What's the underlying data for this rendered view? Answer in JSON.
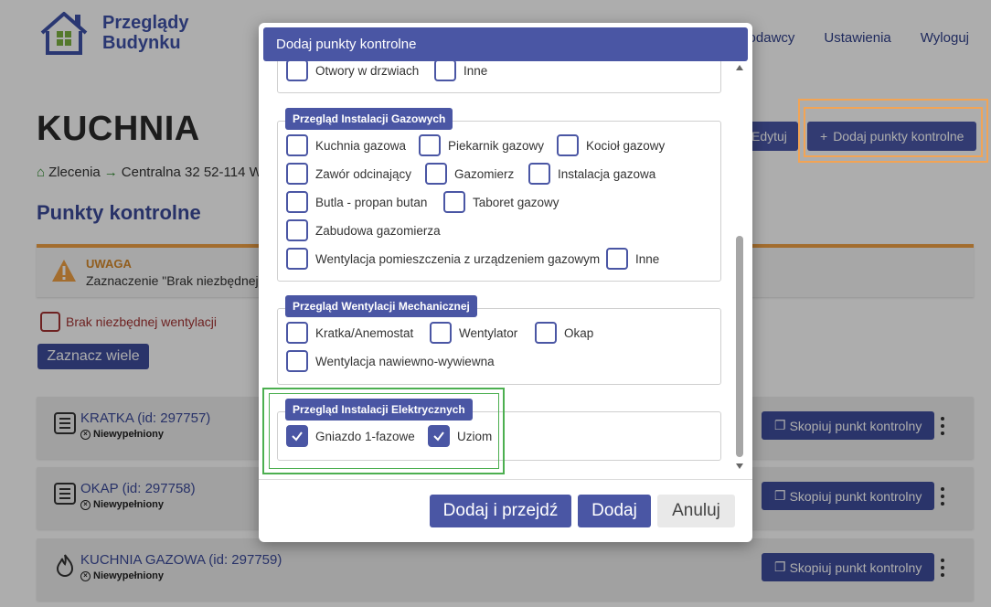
{
  "app": {
    "logo_line1": "Przeglądy",
    "logo_line2": "Budynku",
    "nav": [
      "odawcy",
      "Ustawienia",
      "Wyloguj"
    ]
  },
  "page": {
    "title": "KUCHNIA",
    "breadcrumb": [
      "Zlecenia",
      "Centralna 32 52-114 W"
    ],
    "section_title": "Punkty kontrolne",
    "edit_button": "Edytuj",
    "add_points_button": "Dodaj punkty kontrolne",
    "warning_title": "UWAGA",
    "warning_text": "Zaznaczenie \"Brak niezbędnej w",
    "vent_checkbox_label": "Brak niezbędnej wentylacji",
    "select_many_button": "Zaznacz wiele",
    "items": [
      {
        "name": "KRATKA (id: 297757)",
        "status": "Niewypełniony",
        "icon": "document-list-icon",
        "copy_label": "Skopiuj punkt kontrolny"
      },
      {
        "name": "OKAP (id: 297758)",
        "status": "Niewypełniony",
        "icon": "document-list-icon",
        "copy_label": "Skopiuj punkt kontrolny"
      },
      {
        "name": "KUCHNIA GAZOWA (id: 297759)",
        "status": "Niewypełniony",
        "icon": "flame-icon",
        "copy_label": "Skopiuj punkt kontrolny"
      }
    ]
  },
  "modal": {
    "title": "Dodaj punkty kontrolne",
    "group0": {
      "options": [
        {
          "label": "Otwory w drzwiach",
          "checked": false
        },
        {
          "label": "Inne",
          "checked": false
        }
      ]
    },
    "group1": {
      "label": "Przegląd Instalacji Gazowych",
      "options": [
        {
          "label": "Kuchnia gazowa",
          "checked": false
        },
        {
          "label": "Piekarnik gazowy",
          "checked": false
        },
        {
          "label": "Kocioł gazowy",
          "checked": false
        },
        {
          "label": "Zawór odcinający",
          "checked": false
        },
        {
          "label": "Gazomierz",
          "checked": false
        },
        {
          "label": "Instalacja gazowa",
          "checked": false
        },
        {
          "label": "Butla - propan butan",
          "checked": false
        },
        {
          "label": "Taboret gazowy",
          "checked": false
        },
        {
          "label": "Zabudowa gazomierza",
          "checked": false
        },
        {
          "label": "Wentylacja pomieszczenia z urządzeniem gazowym",
          "checked": false
        },
        {
          "label": "Inne",
          "checked": false
        }
      ]
    },
    "group2": {
      "label": "Przegląd Wentylacji Mechanicznej",
      "options": [
        {
          "label": "Kratka/Anemostat",
          "checked": false
        },
        {
          "label": "Wentylator",
          "checked": false
        },
        {
          "label": "Okap",
          "checked": false
        },
        {
          "label": "Wentylacja nawiewno-wywiewna",
          "checked": false
        }
      ]
    },
    "group3": {
      "label": "Przegląd Instalacji Elektrycznych",
      "options": [
        {
          "label": "Gniazdo 1-fazowe",
          "checked": true
        },
        {
          "label": "Uziom",
          "checked": true
        }
      ]
    },
    "buttons": {
      "add_and_go": "Dodaj i przejdź",
      "add": "Dodaj",
      "cancel": "Anuluj"
    }
  },
  "colors": {
    "primary": "#4a56a4",
    "warning": "#f0a145",
    "highlight_orange": "#f2a455",
    "highlight_green": "#4caf50"
  }
}
